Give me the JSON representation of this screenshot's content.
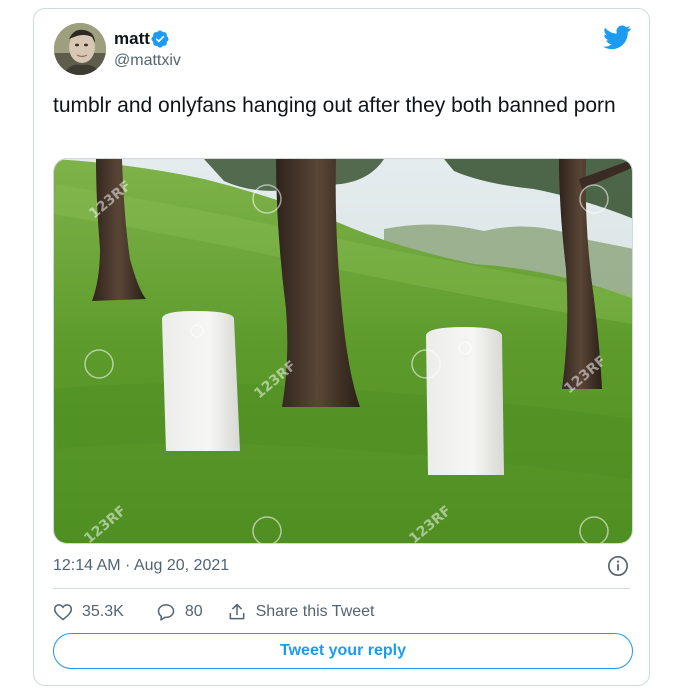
{
  "author": {
    "display_name": "matt",
    "handle": "@mattxiv",
    "verified": true
  },
  "tweet": {
    "text": "tumblr and onlyfans hanging out after they both banned porn",
    "timestamp": "12:14 AM · Aug 20, 2021",
    "media_description": "two white gravestones on a grassy hillside with pine trees"
  },
  "actions": {
    "likes": "35.3K",
    "replies": "80",
    "share_label": "Share this Tweet"
  },
  "reply_button": {
    "label": "Tweet your reply"
  },
  "icons": {
    "verified": "verified-badge-icon",
    "logo": "twitter-bird-icon",
    "info": "info-icon",
    "like": "heart-icon",
    "reply": "speech-bubble-icon",
    "share": "share-upload-icon"
  },
  "colors": {
    "brand_blue": "#1d9bf0",
    "text_primary": "#0f1419",
    "text_secondary": "#536471",
    "border": "#cfd9de"
  }
}
